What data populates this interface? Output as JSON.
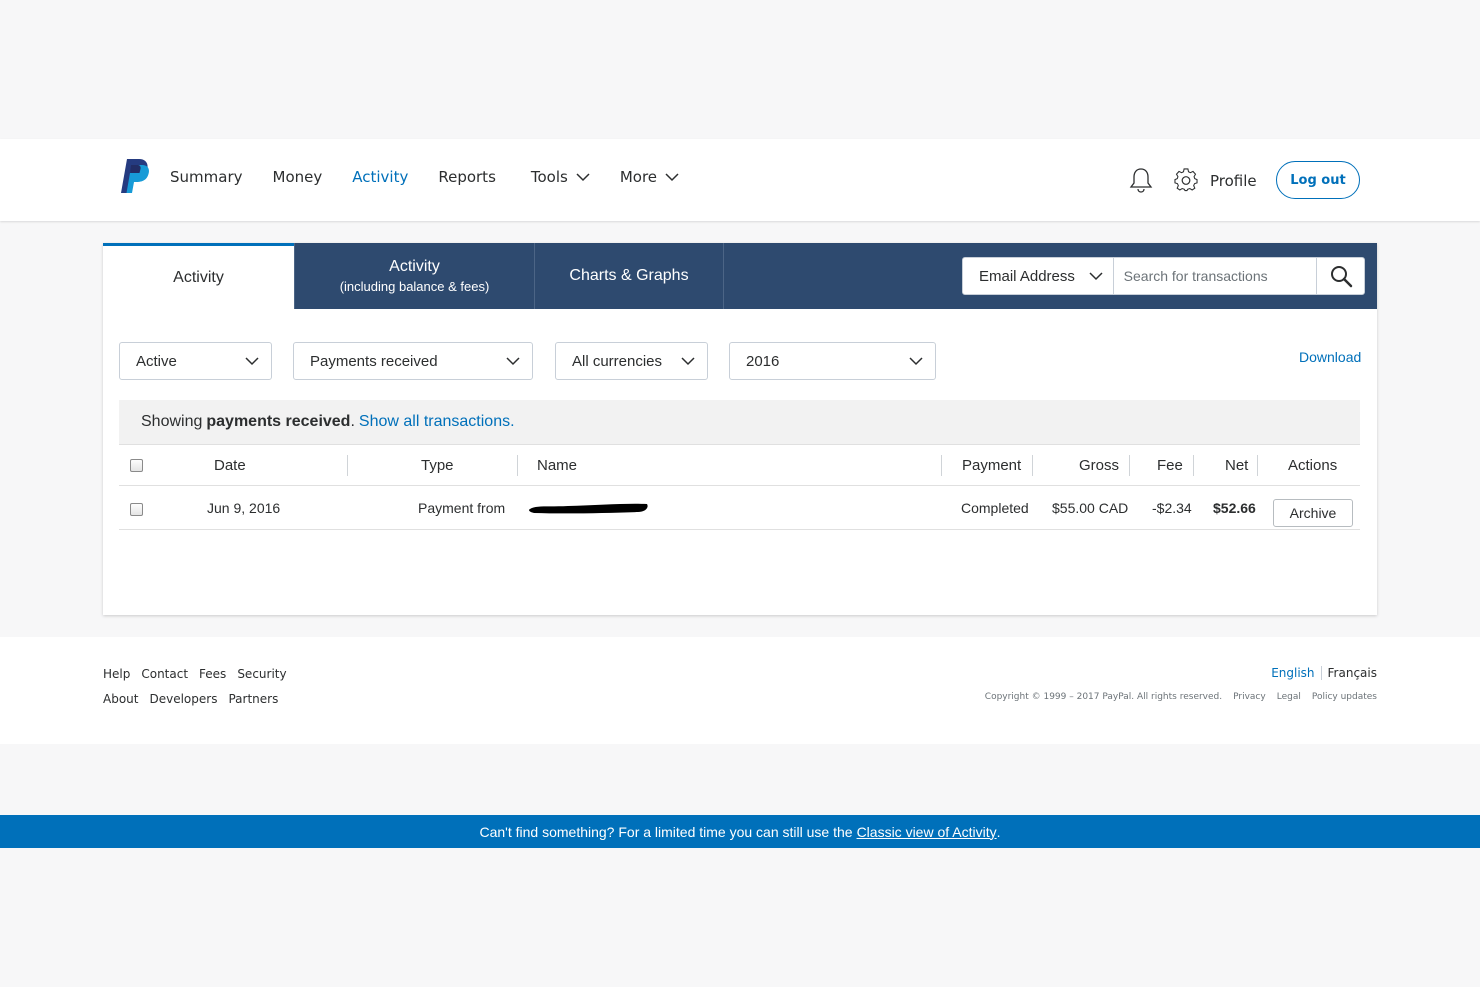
{
  "nav": {
    "items": [
      "Summary",
      "Money",
      "Activity",
      "Reports",
      "Tools",
      "More"
    ],
    "active": "Activity",
    "profile": "Profile",
    "logout": "Log out"
  },
  "tabs": {
    "activity": "Activity",
    "activity_fees": "Activity",
    "activity_fees_sub": "(including balance & fees)",
    "charts": "Charts & Graphs"
  },
  "search": {
    "type": "Email Address",
    "placeholder": "Search for transactions"
  },
  "filters": {
    "status": "Active",
    "type": "Payments received",
    "currency": "All currencies",
    "year": "2016",
    "download": "Download"
  },
  "notice": {
    "prefix": "Showing",
    "bold": "payments received",
    "suffix": ".",
    "link": "Show all transactions."
  },
  "table": {
    "columns": [
      "Date",
      "Type",
      "Name",
      "Payment",
      "Gross",
      "Fee",
      "Net",
      "Actions"
    ],
    "rows": [
      {
        "date": "Jun 9, 2016",
        "type": "Payment from",
        "name": "",
        "payment": "Completed",
        "gross": "$55.00 CAD",
        "fee": "-$2.34",
        "net": "$52.66",
        "action": "Archive"
      }
    ]
  },
  "footer": {
    "links_row1": [
      "Help",
      "Contact",
      "Fees",
      "Security"
    ],
    "links_row2": [
      "About",
      "Developers",
      "Partners"
    ],
    "lang_en": "English",
    "lang_fr": "Français",
    "copyright": "Copyright © 1999 – 2017 PayPal. All rights reserved.",
    "legal_links": [
      "Privacy",
      "Legal",
      "Policy updates"
    ]
  },
  "banner": {
    "text": "Can't find something? For a limited time you can still use the",
    "link": "Classic view of Activity",
    "end": "."
  },
  "colors": {
    "brand_blue": "#0070ba",
    "tab_navy": "#2e4a6f"
  }
}
